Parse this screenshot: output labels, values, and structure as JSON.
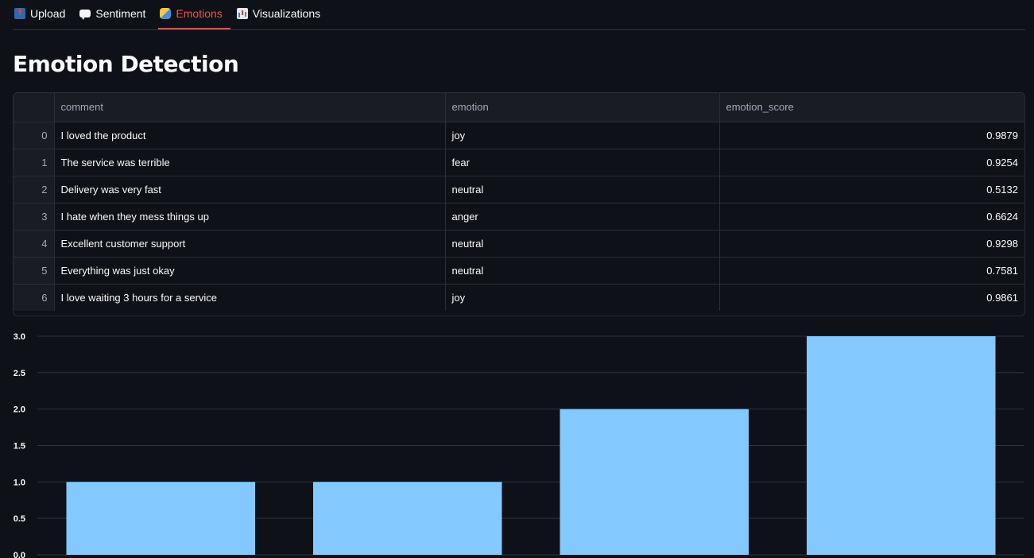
{
  "tabs": [
    {
      "label": "Upload",
      "icon": "upload-icon",
      "active": false
    },
    {
      "label": "Sentiment",
      "icon": "speech-bubble-icon",
      "active": false
    },
    {
      "label": "Emotions",
      "icon": "theater-masks-icon",
      "active": true
    },
    {
      "label": "Visualizations",
      "icon": "bar-chart-icon",
      "active": false
    }
  ],
  "page": {
    "title": "Emotion Detection"
  },
  "table": {
    "columns": [
      "",
      "comment",
      "emotion",
      "emotion_score"
    ],
    "rows": [
      {
        "index": "0",
        "comment": "I loved the product",
        "emotion": "joy",
        "emotion_score": "0.9879"
      },
      {
        "index": "1",
        "comment": "The service was terrible",
        "emotion": "fear",
        "emotion_score": "0.9254"
      },
      {
        "index": "2",
        "comment": "Delivery was very fast",
        "emotion": "neutral",
        "emotion_score": "0.5132"
      },
      {
        "index": "3",
        "comment": "I hate when they mess things up",
        "emotion": "anger",
        "emotion_score": "0.6624"
      },
      {
        "index": "4",
        "comment": "Excellent customer support",
        "emotion": "neutral",
        "emotion_score": "0.9298"
      },
      {
        "index": "5",
        "comment": "Everything was just okay",
        "emotion": "neutral",
        "emotion_score": "0.7581"
      },
      {
        "index": "6",
        "comment": "I love waiting 3 hours for a service",
        "emotion": "joy",
        "emotion_score": "0.9861"
      }
    ]
  },
  "colors": {
    "background": "#0e1117",
    "accent": "#ff4b4b",
    "bar": "#83c9ff",
    "grid": "#31333f"
  },
  "chart_data": {
    "type": "bar",
    "categories": [
      "",
      "",
      "",
      ""
    ],
    "values": [
      1,
      1,
      2,
      3
    ],
    "ylim": [
      0,
      3
    ],
    "yticks": [
      "0.0",
      "0.5",
      "1.0",
      "1.5",
      "2.0",
      "2.5",
      "3.0"
    ],
    "grid": true,
    "title": "",
    "xlabel": "",
    "ylabel": ""
  }
}
